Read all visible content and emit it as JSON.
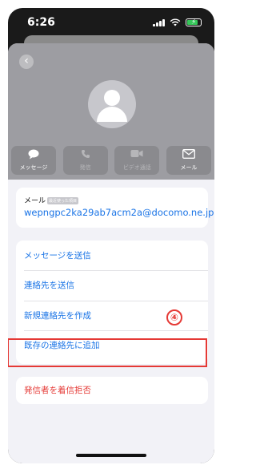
{
  "status": {
    "time": "6:26"
  },
  "header": {
    "actions": [
      {
        "label": "メッセージ",
        "icon": "message-bubble-icon",
        "enabled": true
      },
      {
        "label": "発信",
        "icon": "phone-icon",
        "enabled": false
      },
      {
        "label": "ビデオ通話",
        "icon": "video-camera-icon",
        "enabled": false
      },
      {
        "label": "メール",
        "icon": "envelope-icon",
        "enabled": true
      }
    ]
  },
  "email": {
    "label": "メール",
    "badge": "最近使った項目",
    "value": "wepngpc2ka29ab7acm2a@docomo.ne.jp"
  },
  "options": [
    {
      "label": "メッセージを送信"
    },
    {
      "label": "連絡先を送信"
    },
    {
      "label": "新規連絡先を作成"
    },
    {
      "label": "既存の連絡先に追加"
    }
  ],
  "block": {
    "label": "発信者を着信拒否"
  },
  "annotation": {
    "number": "④",
    "color": "#e53935"
  },
  "colors": {
    "link": "#1a74e6",
    "danger": "#e53935",
    "battery": "#35c759"
  }
}
